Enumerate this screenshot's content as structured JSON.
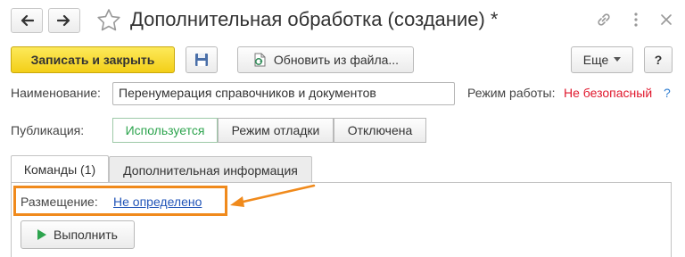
{
  "window": {
    "title": "Дополнительная обработка (создание) *",
    "back_icon": "arrow-left-icon",
    "forward_icon": "arrow-right-icon",
    "favorite_icon": "star-icon",
    "link_icon": "link-icon",
    "menu_icon": "more-vertical-icon",
    "close_icon": "close-icon"
  },
  "toolbar": {
    "save_close_label": "Записать и закрыть",
    "save_icon": "floppy-disk-icon",
    "update_label": "Обновить из файла...",
    "update_icon": "file-update-icon",
    "more_label": "Еще",
    "help_label": "?"
  },
  "form": {
    "name_label": "Наименование:",
    "name_value": "Перенумерация справочников и документов",
    "mode_label": "Режим работы:",
    "mode_value": "Не безопасный",
    "mode_help": "?",
    "publication_label": "Публикация:",
    "publication_options": [
      "Используется",
      "Режим отладки",
      "Отключена"
    ],
    "publication_selected": "Используется"
  },
  "tabs": [
    {
      "label": "Команды (1)",
      "active": true
    },
    {
      "label": "Дополнительная информация",
      "active": false
    }
  ],
  "commands": {
    "placement_label": "Размещение:",
    "placement_value": "Не определено",
    "run_label": "Выполнить",
    "run_icon": "play-icon"
  },
  "colors": {
    "primary_button": "#f3cf18",
    "mode_value": "#e0182d",
    "active_segment": "#2da44e",
    "link": "#2255b8",
    "annotation": "#f08a1c"
  }
}
